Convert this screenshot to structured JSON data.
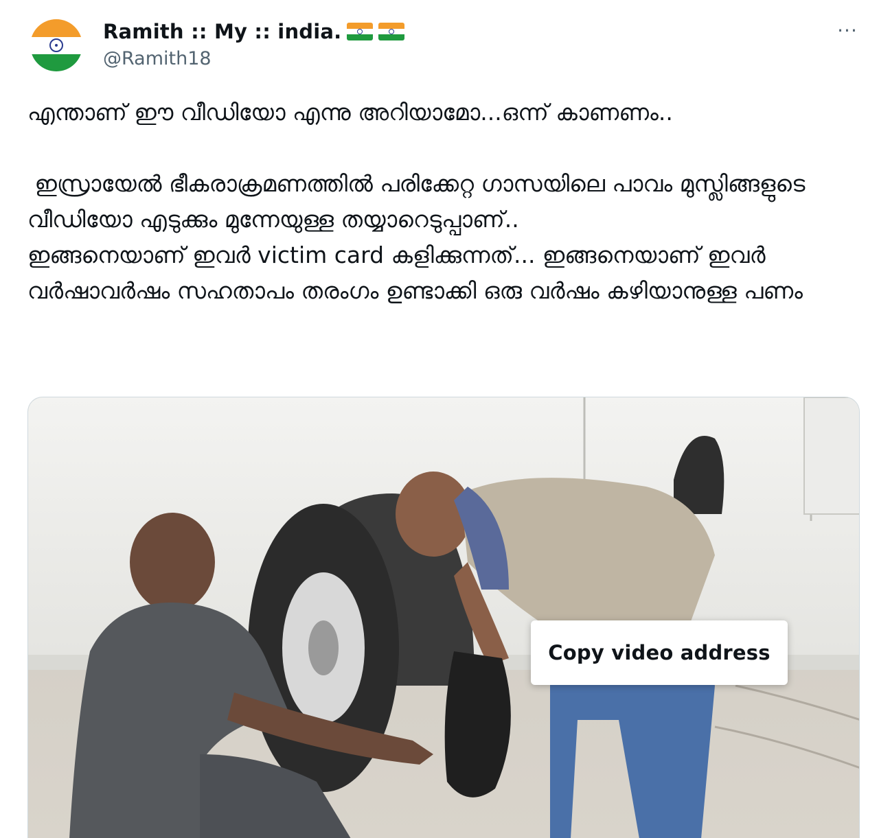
{
  "author": {
    "display_name": "Ramith :: My :: india.",
    "handle": "@Ramith18",
    "name_emojis": [
      "india-flag-icon",
      "india-flag-icon"
    ]
  },
  "tweet": {
    "text": "എന്താണ് ഈ വീഡിയോ എന്നു അറിയാമോ...ഒന്ന് കാണണം..\n\n ഇസ്രായേൽ ഭീകരാക്രമണത്തിൽ പരിക്കേറ്റ ഗാസയിലെ പാവം മുസ്ലിങ്ങളുടെ വീഡിയോ എടുക്കും മുന്നേയുള്ള തയ്യാറെടുപ്പാണ്..\nഇങ്ങനെയാണ് ഇവർ victim card കളിക്കുന്നത്... ഇങ്ങനെയാണ് ഇവർ വർഷാവർഷം സഹതാപം തരംഗം ഉണ്ടാക്കി ഒരു വർഷം കഴിയാനുള്ള പണം"
  },
  "more_menu": {
    "glyph": "···"
  },
  "context_menu": {
    "items": [
      "Copy video address"
    ]
  },
  "colors": {
    "text": "#0f1419",
    "secondary": "#536471",
    "border": "#cfd9de",
    "saffron": "#f39c2b",
    "green": "#1f9a3f",
    "navy": "#2a3b8f"
  }
}
